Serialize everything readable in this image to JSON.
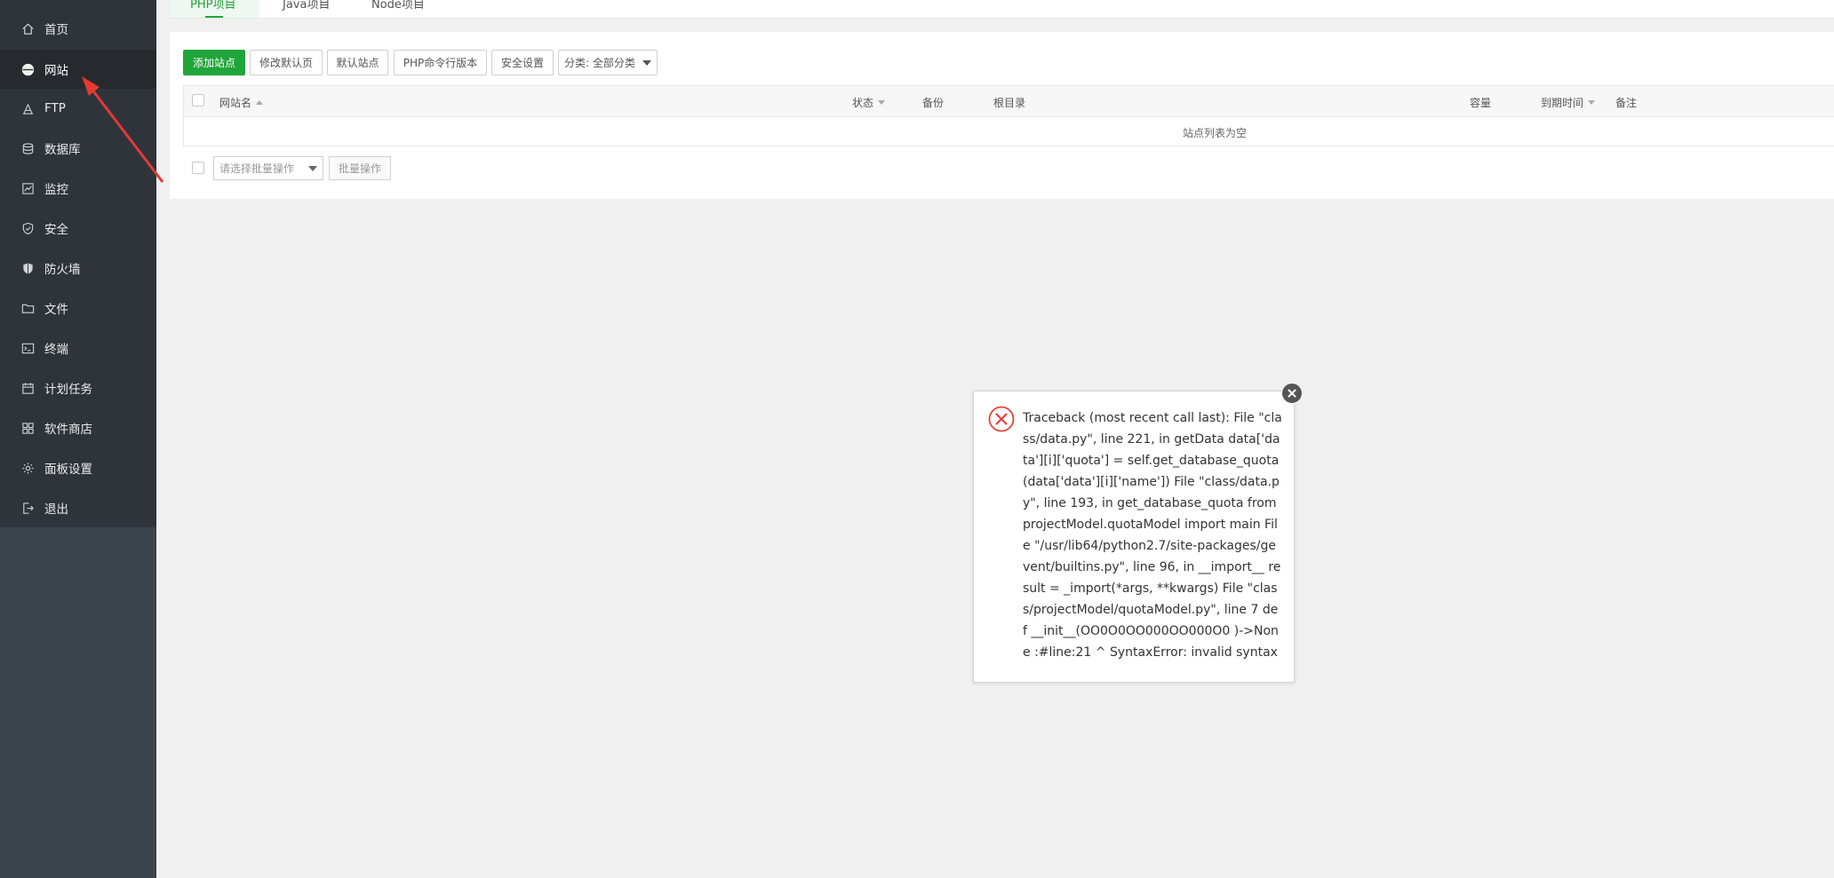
{
  "sidebar": {
    "items": [
      {
        "label": "首页",
        "icon": "home-icon"
      },
      {
        "label": "网站",
        "icon": "globe-icon",
        "active": true
      },
      {
        "label": "FTP",
        "icon": "ftp-icon"
      },
      {
        "label": "数据库",
        "icon": "database-icon"
      },
      {
        "label": "监控",
        "icon": "monitor-icon"
      },
      {
        "label": "安全",
        "icon": "shield-icon"
      },
      {
        "label": "防火墙",
        "icon": "firewall-icon"
      },
      {
        "label": "文件",
        "icon": "folder-icon"
      },
      {
        "label": "终端",
        "icon": "terminal-icon"
      },
      {
        "label": "计划任务",
        "icon": "calendar-icon"
      },
      {
        "label": "软件商店",
        "icon": "apps-icon"
      },
      {
        "label": "面板设置",
        "icon": "gear-icon"
      },
      {
        "label": "退出",
        "icon": "logout-icon"
      }
    ]
  },
  "tabs": [
    {
      "label": "PHP项目",
      "active": true
    },
    {
      "label": "Java项目"
    },
    {
      "label": "Node项目"
    }
  ],
  "toolbar": {
    "add_site": "添加站点",
    "modify_default_page": "修改默认页",
    "default_site": "默认站点",
    "php_cli_version": "PHP命令行版本",
    "security_settings": "安全设置",
    "category_select": "分类: 全部分类"
  },
  "table": {
    "headers": {
      "site_name": "网站名",
      "status": "状态",
      "backup": "备份",
      "root_dir": "根目录",
      "capacity": "容量",
      "expiry": "到期时间",
      "remark": "备注"
    },
    "empty_text": "站点列表为空"
  },
  "batch": {
    "select_placeholder": "请选择批量操作",
    "button": "批量操作"
  },
  "error_dialog": {
    "message": "Traceback (most recent call last): File \"class/data.py\", line 221, in getData data['data'][i]['quota'] = self.get_database_quota(data['data'][i]['name']) File \"class/data.py\", line 193, in get_database_quota from projectModel.quotaModel import main File \"/usr/lib64/python2.7/site-packages/gevent/builtins.py\", line 96, in __import__ result = _import(*args, **kwargs) File \"class/projectModel/quotaModel.py\", line 7 def __init__(OO0O0OO000OO000O0 )->None :#line:21 ^ SyntaxError: invalid syntax"
  },
  "colors": {
    "sidebar_bg": "#2f343b",
    "sidebar_active_bg": "#262a2f",
    "accent_green": "#20a53a",
    "error_red": "#e2443a",
    "annotation_arrow": "#e53935"
  }
}
